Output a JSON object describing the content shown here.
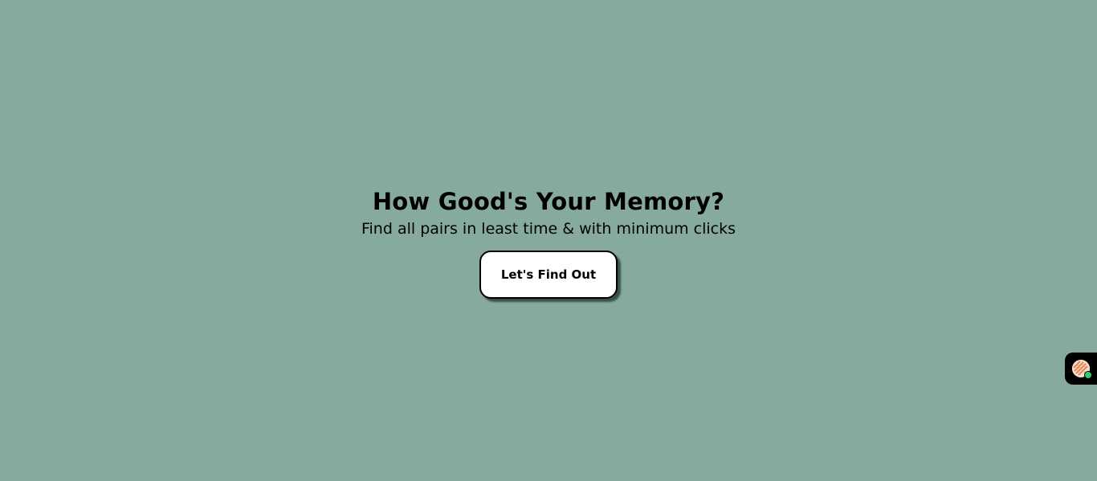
{
  "hero": {
    "title": "How Good's Your Memory?",
    "subtitle": "Find all pairs in least time & with minimum clicks",
    "start_button_label": "Let's Find Out"
  },
  "widget": {
    "icon": "chat-avatar-icon",
    "status": "online",
    "status_color": "#2ecc71"
  },
  "colors": {
    "background": "#86ab9e",
    "button_background": "#ffffff",
    "text": "#000000"
  }
}
